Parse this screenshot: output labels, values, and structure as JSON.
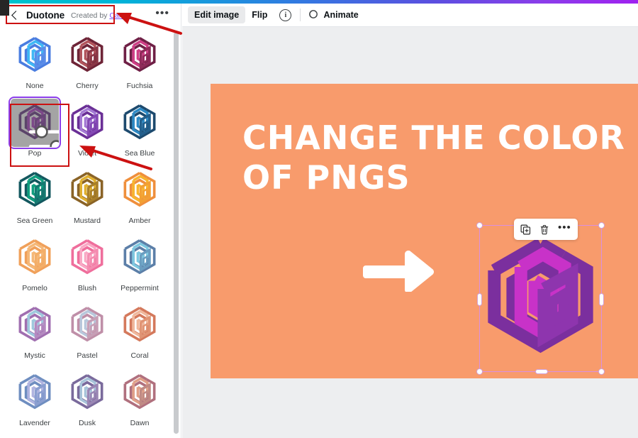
{
  "window": {
    "accent_gradient_from": "#00c4cc",
    "accent_gradient_to": "#a020f0"
  },
  "sidebar": {
    "back_icon": "chevron-left-icon",
    "title": "Duotone",
    "credit_prefix": "Created by",
    "credit_link": "Canva",
    "more_label": "•••",
    "selected_effect": "Pop",
    "selected_overlay_icon": "sliders-adjust-icon",
    "effects": [
      {
        "label": "None",
        "outer": "#4a7de0",
        "mid": "#3fb8f5",
        "inner": "#5a8ce8"
      },
      {
        "label": "Cherry",
        "outer": "#6e2437",
        "mid": "#b2555c",
        "inner": "#8a3746"
      },
      {
        "label": "Fuchsia",
        "outer": "#6f2046",
        "mid": "#cf3f86",
        "inner": "#8e2a59"
      },
      {
        "label": "Pop",
        "outer": "#5d2a7e",
        "mid": "#a936c4",
        "inner": "#7a2f9c"
      },
      {
        "label": "Violet",
        "outer": "#6a2f96",
        "mid": "#a47ad4",
        "inner": "#8348b4"
      },
      {
        "label": "Sea Blue",
        "outer": "#1d4a6e",
        "mid": "#2d89c4",
        "inner": "#235f8c"
      },
      {
        "label": "Sea Green",
        "outer": "#13585f",
        "mid": "#0f9e7e",
        "inner": "#147a71"
      },
      {
        "label": "Mustard",
        "outer": "#8a6326",
        "mid": "#e0b030",
        "inner": "#a87f2a"
      },
      {
        "label": "Amber",
        "outer": "#ef8f3c",
        "mid": "#f7b52e",
        "inner": "#f2a033"
      },
      {
        "label": "Pomelo",
        "outer": "#f0a05a",
        "mid": "#f5b878",
        "inner": "#f3ae68"
      },
      {
        "label": "Blush",
        "outer": "#ef6e9c",
        "mid": "#f9a9c5",
        "inner": "#f48cb0"
      },
      {
        "label": "Peppermint",
        "outer": "#5c7fa8",
        "mid": "#7ec8e0",
        "inner": "#6a9dc0"
      },
      {
        "label": "Mystic",
        "outer": "#a06fb0",
        "mid": "#9fc8dd",
        "inner": "#b48ac0"
      },
      {
        "label": "Pastel",
        "outer": "#bf8fa8",
        "mid": "#b8c8dc",
        "inner": "#c79fb6"
      },
      {
        "label": "Coral",
        "outer": "#d4795c",
        "mid": "#f0b89c",
        "inner": "#e09474"
      },
      {
        "label": "Lavender",
        "outer": "#6f8ec0",
        "mid": "#b0b4e0",
        "inner": "#8a9ed0"
      },
      {
        "label": "Dusk",
        "outer": "#7a6a9c",
        "mid": "#a8c4da",
        "inner": "#9a86b4"
      },
      {
        "label": "Dawn",
        "outer": "#b0707e",
        "mid": "#e0a088",
        "inner": "#c08a84"
      }
    ]
  },
  "toolbar": {
    "edit_image_label": "Edit image",
    "flip_label": "Flip",
    "info_label": "i",
    "animate_label": "Animate",
    "animate_icon": "animate-circle-icon"
  },
  "canvas": {
    "background": "#edeef0",
    "page_background": "#f89b6c",
    "headline": "CHANGE THE COLOR\nOF PNGS",
    "arrow_icon": "right-arrow-shape",
    "element_toolbar": {
      "duplicate_icon": "duplicate-icon",
      "delete_icon": "trash-icon",
      "more_label": "•••"
    },
    "rotate_icon": "rotate-icon",
    "selected_art": {
      "outer": "#7b2f9e",
      "mid": "#c832c8",
      "inner": "#8e35ae",
      "selection_border": "#d98fe0"
    }
  },
  "annotations": {
    "color": "#cc1111",
    "highlight_header": true,
    "highlight_pop": true
  }
}
